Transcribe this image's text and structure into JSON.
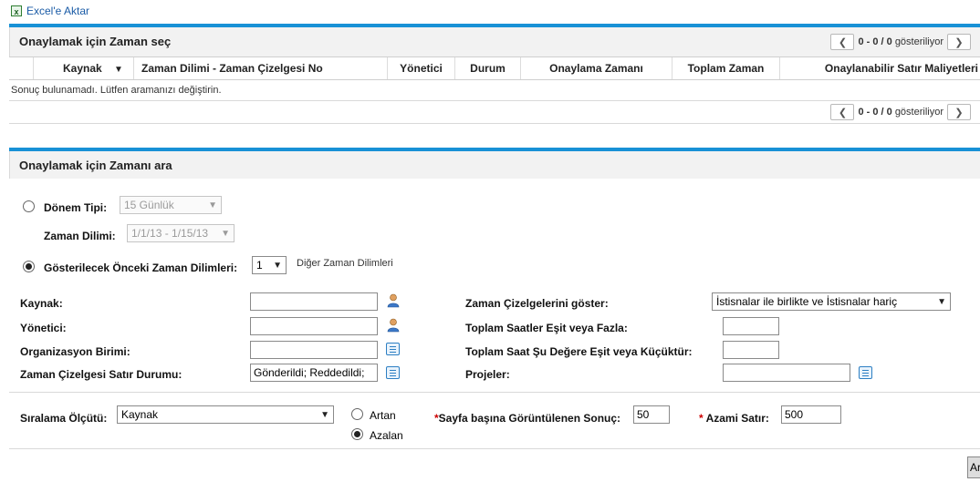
{
  "export": {
    "label": "Excel'e Aktar"
  },
  "results_panel": {
    "title": "Onaylamak için Zaman seç",
    "pager": {
      "range": "0 - 0 / 0",
      "suffix": "gösteriliyor"
    },
    "columns": [
      "Kaynak",
      "Zaman Dilimi - Zaman Çizelgesi No",
      "Yönetici",
      "Durum",
      "Onaylama Zamanı",
      "Toplam Zaman",
      "Onaylanabilir Satır Maliyetleri"
    ],
    "sort_indicator": "▼",
    "empty_message": "Sonuç bulunamadı. Lütfen aramanızı değiştirin."
  },
  "search_panel": {
    "title": "Onaylamak için Zamanı ara",
    "period_type": {
      "label": "Dönem Tipi:",
      "value": "15 Günlük"
    },
    "time_period": {
      "label": "Zaman Dilimi:",
      "value": "1/1/13 - 1/15/13"
    },
    "previous_periods": {
      "label": "Gösterilecek Önceki Zaman Dilimleri:",
      "value": "1",
      "link": "Diğer Zaman Dilimleri"
    },
    "fields": {
      "resource": {
        "label": "Kaynak:",
        "value": ""
      },
      "manager": {
        "label": "Yönetici:",
        "value": ""
      },
      "org_unit": {
        "label": "Organizasyon Birimi:",
        "value": ""
      },
      "line_status": {
        "label": "Zaman Çizelgesi Satır Durumu:",
        "value": "Gönderildi; Reddedildi;"
      },
      "show_timesheets": {
        "label": "Zaman Çizelgelerini göster:",
        "value": "İstisnalar ile birlikte ve İstisnalar hariç"
      },
      "hours_gte": {
        "label": "Toplam Saatler Eşit veya Fazla:",
        "value": ""
      },
      "hours_lte": {
        "label": "Toplam Saat Şu Değere Eşit veya Küçüktür:",
        "value": ""
      },
      "projects": {
        "label": "Projeler:",
        "value": ""
      }
    },
    "sort": {
      "label": "Sıralama Ölçütü:",
      "value": "Kaynak",
      "asc": "Artan",
      "desc": "Azalan",
      "selected": "desc"
    },
    "page_size": {
      "required": "*",
      "label": "Sayfa başına Görüntülenen Sonuç:",
      "value": "50"
    },
    "max_rows": {
      "required": "*",
      "label": "Azami Satır:",
      "value": "500"
    },
    "search_button": "Ar"
  },
  "colors": {
    "accent": "#1891d6",
    "link": "#1a5ba6",
    "required": "#cc0000"
  }
}
